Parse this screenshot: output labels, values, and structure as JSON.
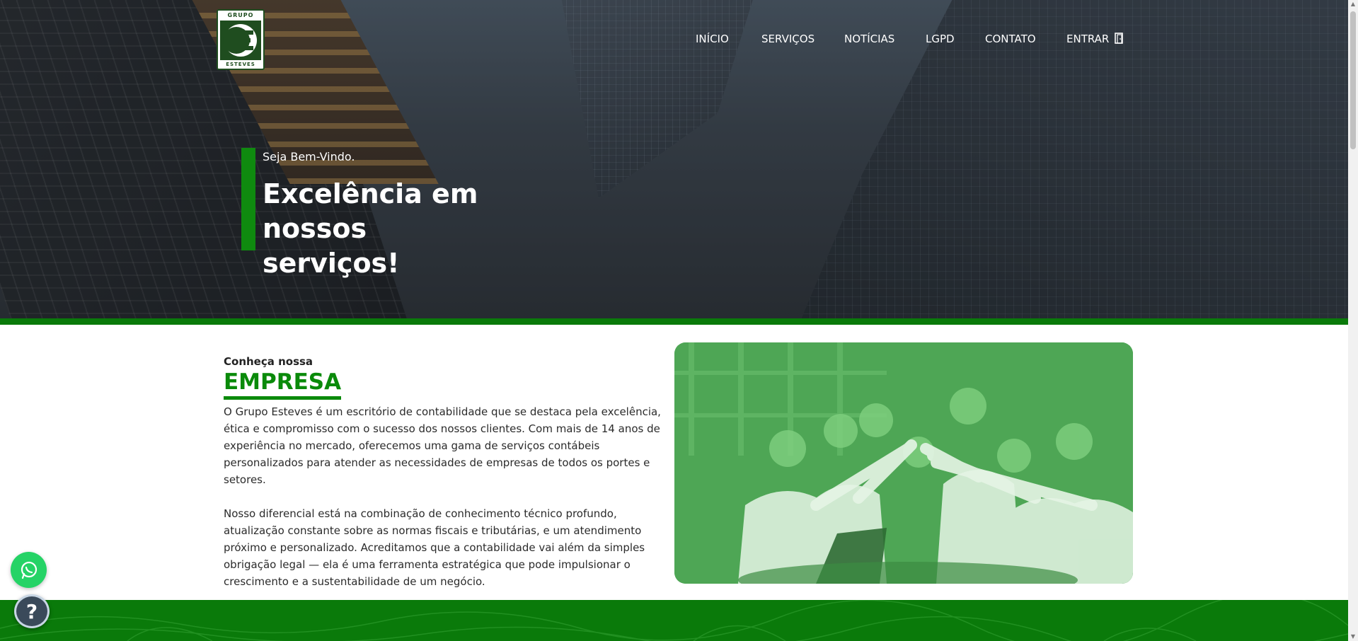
{
  "header": {
    "logo": {
      "top_text": "GRUPO",
      "bottom_text": "ESTEVES",
      "letter": "E"
    },
    "nav": [
      {
        "label": "INÍCIO"
      },
      {
        "label": "SERVIÇOS"
      },
      {
        "label": "NOTÍCIAS"
      },
      {
        "label": "LGPD"
      },
      {
        "label": "CONTATO"
      },
      {
        "label": "ENTRAR",
        "icon": "door-icon"
      }
    ]
  },
  "hero": {
    "kicker": "Seja Bem-Vindo.",
    "title": "Excelência em nossos serviços!"
  },
  "about": {
    "kicker": "Conheça nossa",
    "title": "EMPRESA",
    "paragraphs": [
      "O Grupo Esteves é um escritório de contabilidade que se destaca pela excelência, ética e compromisso com o sucesso dos nossos clientes. Com mais de 14 anos de experiência no mercado, oferecemos uma gama de serviços contábeis personalizados para atender as necessidades de empresas de todos os portes e setores.",
      "Nosso diferencial está na combinação de conhecimento técnico profundo, atualização constante sobre as normas fiscais e tributárias, e um atendimento próximo e personalizado. Acreditamos que a contabilidade vai além da simples obrigação legal — ela é uma ferramenta estratégica que pode impulsionar o crescimento e a sustentabilidade de um negócio."
    ]
  },
  "floating": {
    "whatsapp_icon": "whatsapp-icon",
    "help_label": "?"
  },
  "colors": {
    "brand_green": "#0a7a0a",
    "title_green": "#0a8a0a",
    "whatsapp": "#25d366"
  }
}
